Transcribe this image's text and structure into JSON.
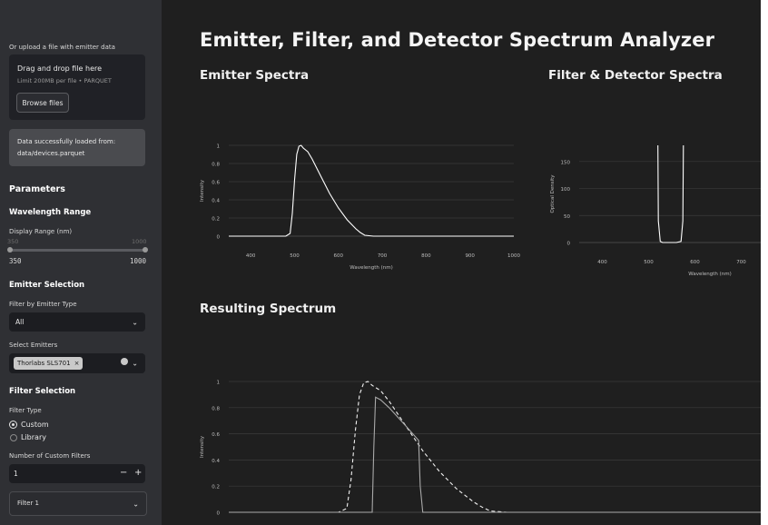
{
  "sidebar": {
    "upload_label": "Or upload a file with emitter data",
    "dropzone_title": "Drag and drop file here",
    "dropzone_hint": "Limit 200MB per file • PARQUET",
    "browse_button": "Browse files",
    "success_line1": "Data successfully loaded from:",
    "success_line2": "data/devices.parquet",
    "parameters_heading": "Parameters",
    "wavelength_heading": "Wavelength Range",
    "display_range_label": "Display Range (nm)",
    "slider_min_top": "350",
    "slider_max_top": "1000",
    "slider_min": "350",
    "slider_max": "1000",
    "emitter_heading": "Emitter Selection",
    "filter_type_label": "Filter by Emitter Type",
    "filter_type_value": "All",
    "select_emitters_label": "Select Emitters",
    "selected_emitter": "Thorlabs SLS701",
    "filter_heading": "Filter Selection",
    "filter_type_radio_label": "Filter Type",
    "radio_custom": "Custom",
    "radio_library": "Library",
    "num_filters_label": "Number of Custom Filters",
    "num_filters_value": "1",
    "minus": "−",
    "plus": "+",
    "filter1_label": "Filter 1"
  },
  "main": {
    "title": "Emitter, Filter, and Detector Spectrum Analyzer",
    "emitter_section": "Emitter Spectra",
    "filter_section": "Filter & Detector Spectra",
    "result_section": "Resulting Spectrum"
  },
  "colors": {
    "background": "#1f1f1f",
    "sidebar": "#2f3034",
    "line": "#ffffff",
    "grid": "#3a3a3a"
  },
  "chart_data": [
    {
      "type": "line",
      "title": "",
      "xlabel": "Wavelength (nm)",
      "ylabel": "Intensity",
      "xlim": [
        350,
        1000
      ],
      "ylim": [
        0,
        1
      ],
      "x_ticks": [
        400,
        500,
        600,
        700,
        800,
        900,
        1000
      ],
      "y_ticks": [
        0,
        0.2,
        0.4,
        0.6,
        0.8,
        1
      ],
      "grid": true,
      "series": [
        {
          "x": [
            350,
            480,
            490,
            495,
            500,
            505,
            510,
            515,
            520,
            530,
            540,
            560,
            580,
            600,
            620,
            640,
            650,
            660,
            680,
            700,
            750,
            800,
            900,
            1000
          ],
          "values": [
            0,
            0,
            0.03,
            0.25,
            0.62,
            0.9,
            0.99,
            1.0,
            0.97,
            0.93,
            0.85,
            0.66,
            0.47,
            0.31,
            0.18,
            0.08,
            0.04,
            0.01,
            0,
            0,
            0,
            0,
            0,
            0
          ]
        }
      ]
    },
    {
      "type": "line",
      "title": "",
      "xlabel": "Wavelength (nm)",
      "ylabel": "Optical Density",
      "xlim": [
        350,
        750
      ],
      "ylim": [
        0,
        180
      ],
      "x_ticks": [
        400,
        500,
        600,
        700
      ],
      "y_ticks": [
        0,
        50,
        100,
        150
      ],
      "grid": true,
      "series": [
        {
          "x": [
            520,
            521,
            525,
            530,
            560,
            570,
            574,
            575
          ],
          "values": [
            180,
            40,
            2,
            0,
            0,
            2,
            40,
            180
          ]
        }
      ]
    },
    {
      "type": "line",
      "title": "",
      "xlabel": "",
      "ylabel": "Intensity",
      "xlim": [
        350,
        1000
      ],
      "ylim": [
        0,
        1
      ],
      "y_ticks": [
        0,
        0.2,
        0.4,
        0.6,
        0.8,
        1
      ],
      "grid": true,
      "series": [
        {
          "style": "dashed",
          "x": [
            350,
            480,
            490,
            495,
            500,
            505,
            510,
            515,
            520,
            530,
            540,
            560,
            580,
            600,
            620,
            640,
            650,
            660,
            680,
            700,
            800,
            1000
          ],
          "values": [
            0,
            0,
            0.03,
            0.25,
            0.62,
            0.9,
            0.99,
            1.0,
            0.97,
            0.93,
            0.85,
            0.66,
            0.47,
            0.31,
            0.18,
            0.08,
            0.04,
            0.01,
            0,
            0,
            0,
            0
          ]
        },
        {
          "style": "solid",
          "x": [
            350,
            520,
            522,
            524,
            530,
            540,
            560,
            575,
            577,
            580,
            1000
          ],
          "values": [
            0,
            0,
            0.5,
            0.88,
            0.86,
            0.8,
            0.66,
            0.55,
            0.2,
            0,
            0
          ]
        }
      ]
    }
  ]
}
